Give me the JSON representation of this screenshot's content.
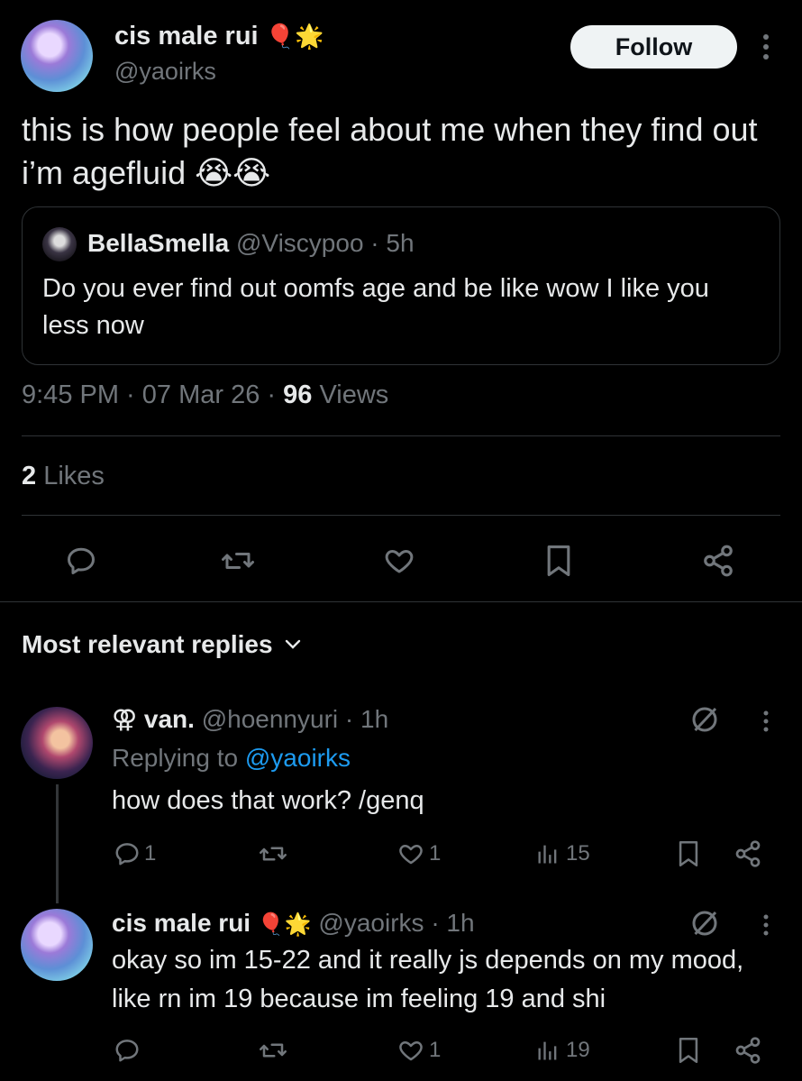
{
  "main_tweet": {
    "display_name": "cis male rui",
    "name_emojis": "🎈🌟",
    "handle": "@yaoirks",
    "follow_label": "Follow",
    "text": "this is how people feel about me when they find out i’m agefluid 😭😭",
    "timestamp": "9:45 PM · 07 Mar 26 · ",
    "views_count": "96",
    "views_label": " Views",
    "likes_count": "2",
    "likes_label": " Likes"
  },
  "quoted_tweet": {
    "display_name": "BellaSmella",
    "handle": "@Viscypoo",
    "time": "· 5h",
    "text": "Do you ever find out oomfs age and be like wow I like you less now"
  },
  "replies_header": {
    "label": "Most relevant replies"
  },
  "replies": [
    {
      "name_prefix": "⚢",
      "display_name": "van.",
      "name_emojis": "",
      "handle": "@hoennyuri",
      "time": "· 1h",
      "replying_to_label": "Replying to ",
      "replying_to_handle": "@yaoirks",
      "text": "how does that work? /genq",
      "reply_count": "1",
      "like_count": "1",
      "view_count": "15"
    },
    {
      "name_prefix": "",
      "display_name": "cis male rui",
      "name_emojis": "🎈🌟",
      "handle": "@yaoirks",
      "time": "· 1h",
      "text": "okay so im 15-22 and it really js depends on my mood, like rn im 19 because im feeling 19 and shi",
      "reply_count": "",
      "like_count": "1",
      "view_count": "19"
    }
  ],
  "colors": {
    "background": "#000000",
    "text": "#e7e9ea",
    "muted": "#71767b",
    "link": "#1d9bf0",
    "border": "#2f3336"
  }
}
